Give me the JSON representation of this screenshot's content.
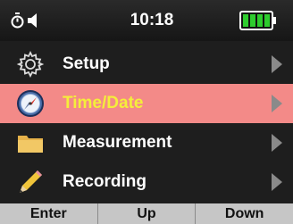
{
  "status_bar": {
    "time": "10:18",
    "icons": [
      "timer-icon",
      "speaker-icon",
      "battery-full-icon"
    ],
    "battery_color": "#2ecc2e"
  },
  "menu": {
    "items": [
      {
        "label": "Setup",
        "icon": "gear-icon",
        "selected": false
      },
      {
        "label": "Time/Date",
        "icon": "compass-clock-icon",
        "selected": true
      },
      {
        "label": "Measurement",
        "icon": "folder-icon",
        "selected": false
      },
      {
        "label": "Recording",
        "icon": "pencil-icon",
        "selected": false
      }
    ],
    "selected_bg_color": "#f38a88",
    "selected_text_color": "#f5ee3a",
    "chevron_icon": "chevron-right-icon"
  },
  "softkeys": {
    "enter": "Enter",
    "up": "Up",
    "down": "Down"
  }
}
